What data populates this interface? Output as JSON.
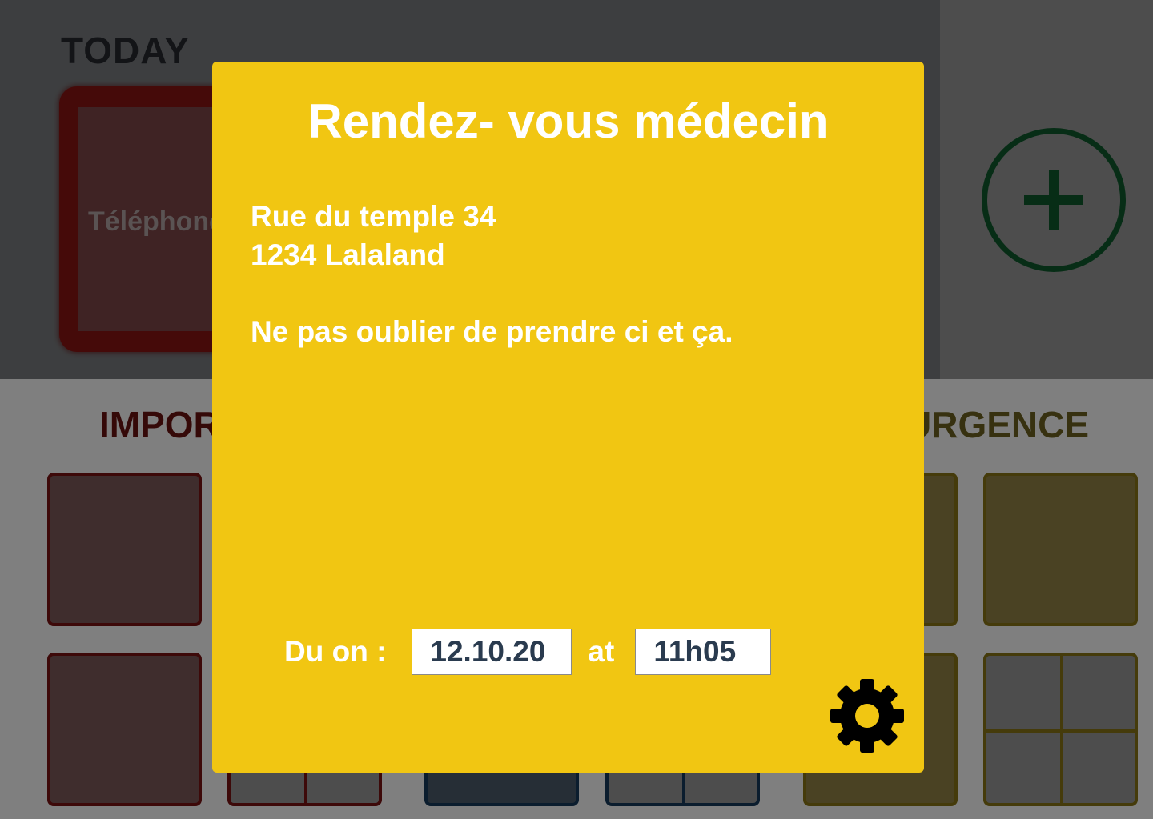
{
  "background": {
    "today_title": "TODAY",
    "today_card_label": "Téléphone",
    "section_important": "IMPORTANT",
    "section_urgence": "URGENCE",
    "add_icon": "plus-circle-icon"
  },
  "modal": {
    "title": "Rendez- vous médecin",
    "address_line1": "Rue du temple 34",
    "address_line2": "1234 Lalaland",
    "note": "Ne pas oublier de prendre ci et ça.",
    "due_label": "Du on :",
    "date_value": "12.10.20",
    "at_label": "at",
    "time_value": "11h05",
    "settings_icon": "gear-icon"
  },
  "colors": {
    "modal_background": "#f1c612",
    "important": "#7a1312",
    "urgence": "#8a7716",
    "add_button": "#0e5a2c",
    "field_text": "#2a3b4f"
  }
}
